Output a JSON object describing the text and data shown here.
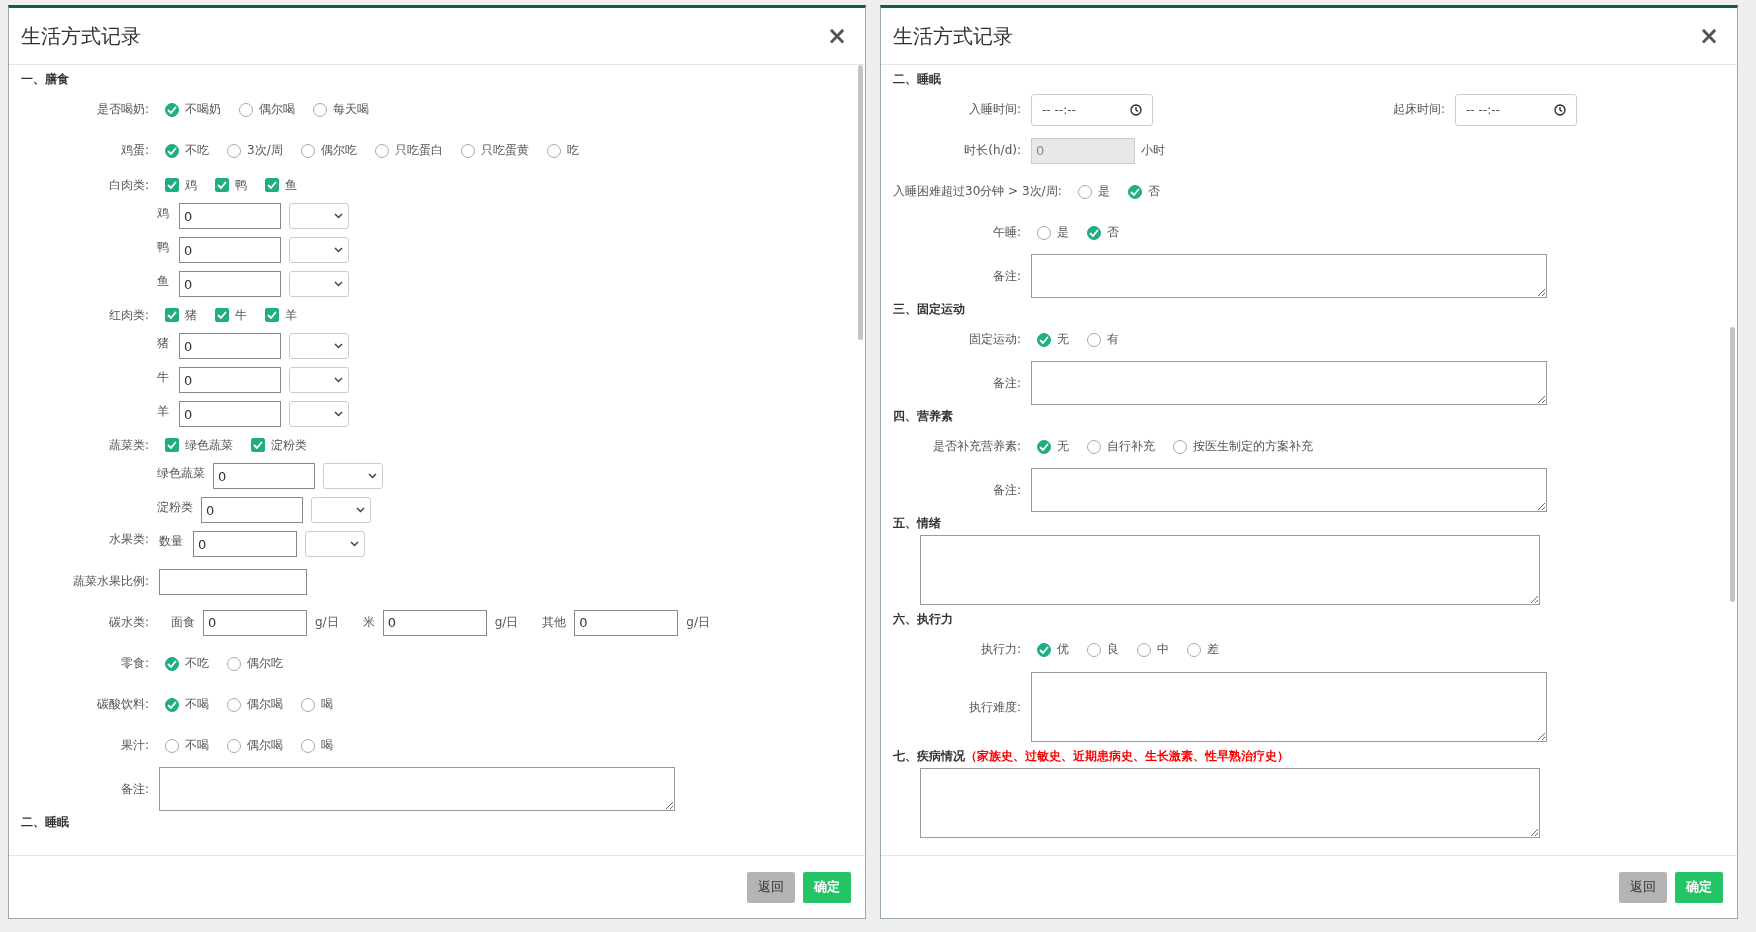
{
  "dialogs": [
    {
      "title": "生活方式记录",
      "close": "×",
      "rows": [
        {
          "kind": "heading",
          "text": "一、膳食"
        },
        {
          "kind": "radio",
          "label": "是否喝奶:",
          "options": [
            {
              "label": "不喝奶",
              "selected": true
            },
            {
              "label": "偶尔喝",
              "selected": false
            },
            {
              "label": "每天喝",
              "selected": false
            }
          ]
        },
        {
          "kind": "radio",
          "label": "鸡蛋:",
          "options": [
            {
              "label": "不吃",
              "selected": true
            },
            {
              "label": "3次/周",
              "selected": false
            },
            {
              "label": "偶尔吃",
              "selected": false
            },
            {
              "label": "只吃蛋白",
              "selected": false
            },
            {
              "label": "只吃蛋黄",
              "selected": false
            },
            {
              "label": "吃",
              "selected": false
            }
          ]
        },
        {
          "kind": "check",
          "label": "白肉类:",
          "options": [
            {
              "label": "鸡",
              "checked": true
            },
            {
              "label": "鸭",
              "checked": true
            },
            {
              "label": "鱼",
              "checked": true
            }
          ]
        },
        {
          "kind": "amount",
          "sublabel": "鸡",
          "value": "0"
        },
        {
          "kind": "amount",
          "sublabel": "鸭",
          "value": "0"
        },
        {
          "kind": "amount",
          "sublabel": "鱼",
          "value": "0"
        },
        {
          "kind": "check",
          "label": "红肉类:",
          "options": [
            {
              "label": "猪",
              "checked": true
            },
            {
              "label": "牛",
              "checked": true
            },
            {
              "label": "羊",
              "checked": true
            }
          ]
        },
        {
          "kind": "amount",
          "sublabel": "猪",
          "value": "0"
        },
        {
          "kind": "amount",
          "sublabel": "牛",
          "value": "0"
        },
        {
          "kind": "amount",
          "sublabel": "羊",
          "value": "0"
        },
        {
          "kind": "check",
          "label": "蔬菜类:",
          "options": [
            {
              "label": "绿色蔬菜",
              "checked": true
            },
            {
              "label": "淀粉类",
              "checked": true
            }
          ]
        },
        {
          "kind": "amount",
          "sublabel": "绿色蔬菜",
          "value": "0"
        },
        {
          "kind": "amount",
          "sublabel": "淀粉类",
          "value": "0"
        },
        {
          "kind": "amount",
          "label": "水果类:",
          "sublabel": "数量",
          "value": "0"
        },
        {
          "kind": "text",
          "label": "蔬菜水果比例:"
        },
        {
          "kind": "multi",
          "label": "碳水类:",
          "items": [
            {
              "prefix": "面食",
              "value": "0",
              "unit": "g/日"
            },
            {
              "prefix": "米",
              "value": "0",
              "unit": "g/日"
            },
            {
              "prefix": "其他",
              "value": "0",
              "unit": "g/日"
            }
          ]
        },
        {
          "kind": "radio",
          "label": "零食:",
          "options": [
            {
              "label": "不吃",
              "selected": true
            },
            {
              "label": "偶尔吃",
              "selected": false
            }
          ]
        },
        {
          "kind": "radio",
          "label": "碳酸饮料:",
          "options": [
            {
              "label": "不喝",
              "selected": true
            },
            {
              "label": "偶尔喝",
              "selected": false
            },
            {
              "label": "喝",
              "selected": false
            }
          ]
        },
        {
          "kind": "radio",
          "label": "果汁:",
          "options": [
            {
              "label": "不喝",
              "selected": false
            },
            {
              "label": "偶尔喝",
              "selected": false
            },
            {
              "label": "喝",
              "selected": false
            }
          ]
        },
        {
          "kind": "memo",
          "label": "备注:"
        },
        {
          "kind": "heading",
          "text": "二、睡眠"
        }
      ],
      "buttons": [
        {
          "label": "返回",
          "kind": "secondary"
        },
        {
          "label": "确定",
          "kind": "primary"
        }
      ]
    },
    {
      "title": "生活方式记录",
      "close": "×",
      "rows": [
        {
          "kind": "heading",
          "text": "二、睡眠"
        },
        {
          "kind": "time",
          "fields": [
            {
              "label": "入睡时间:",
              "value": "-- --:--"
            },
            {
              "label": "起床时间:",
              "value": "-- --:--"
            }
          ]
        },
        {
          "kind": "readonly",
          "label": "时长(h/d):",
          "value": "0",
          "unit": "小时",
          "disabled": true
        },
        {
          "kind": "radio",
          "label": "入睡困难超过30分钟 > 3次/周:",
          "options": [
            {
              "label": "是",
              "selected": false
            },
            {
              "label": "否",
              "selected": true
            }
          ]
        },
        {
          "kind": "radio",
          "label": "午睡:",
          "options": [
            {
              "label": "是",
              "selected": false
            },
            {
              "label": "否",
              "selected": true
            }
          ]
        },
        {
          "kind": "memo",
          "label": "备注:"
        },
        {
          "kind": "heading",
          "text": "三、固定运动"
        },
        {
          "kind": "radio",
          "label": "固定运动:",
          "options": [
            {
              "label": "无",
              "selected": true
            },
            {
              "label": "有",
              "selected": false
            }
          ]
        },
        {
          "kind": "memo",
          "label": "备注:"
        },
        {
          "kind": "heading",
          "text": "四、营养素"
        },
        {
          "kind": "radio",
          "label": "是否补充营养素:",
          "options": [
            {
              "label": "无",
              "selected": true
            },
            {
              "label": "自行补充",
              "selected": false
            },
            {
              "label": "按医生制定的方案补充",
              "selected": false
            }
          ]
        },
        {
          "kind": "memo",
          "label": "备注:"
        },
        {
          "kind": "heading",
          "text": "五、情绪"
        },
        {
          "kind": "textarea"
        },
        {
          "kind": "heading",
          "text": "六、执行力"
        },
        {
          "kind": "radio",
          "label": "执行力:",
          "options": [
            {
              "label": "优",
              "selected": true
            },
            {
              "label": "良",
              "selected": false
            },
            {
              "label": "中",
              "selected": false
            },
            {
              "label": "差",
              "selected": false
            }
          ]
        },
        {
          "kind": "textarea",
          "label": "执行难度:"
        },
        {
          "kind": "heading",
          "text": "七、疾病情况",
          "note": "（家族史、过敏史、近期患病史、生长激素、性早熟治疗史）"
        },
        {
          "kind": "textarea"
        }
      ],
      "buttons": [
        {
          "label": "返回",
          "kind": "secondary"
        },
        {
          "label": "确定",
          "kind": "primary"
        }
      ]
    }
  ]
}
